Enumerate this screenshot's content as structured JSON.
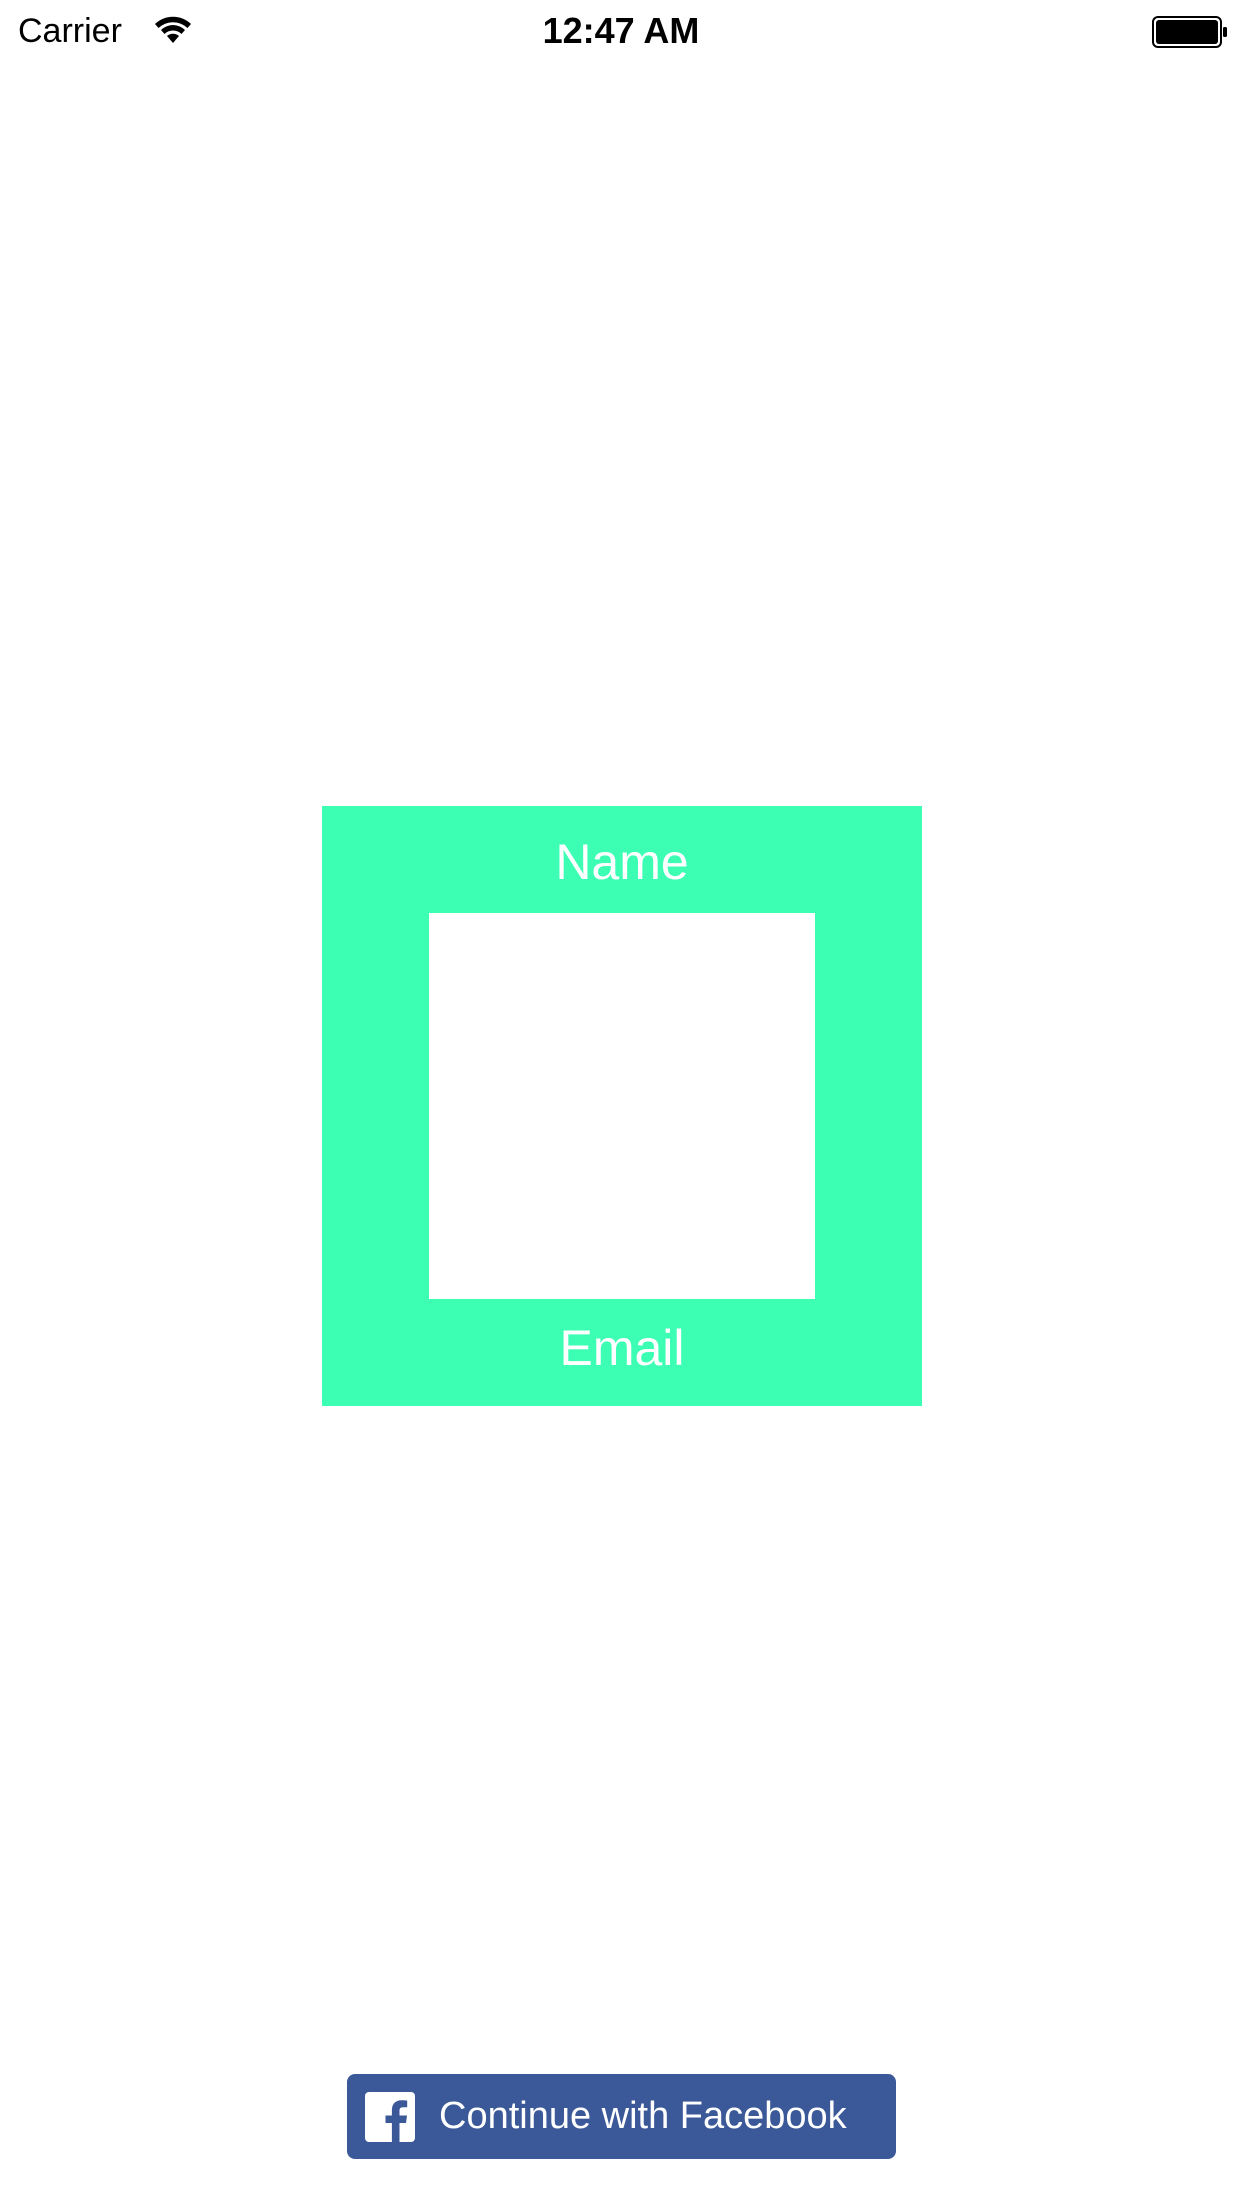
{
  "status_bar": {
    "carrier": "Carrier",
    "time": "12:47 AM",
    "icons": [
      "wifi-icon",
      "battery-icon"
    ]
  },
  "profile": {
    "name_label": "Name",
    "email_label": "Email",
    "accent_color": "#3cffb4"
  },
  "login": {
    "facebook_label": "Continue with Facebook",
    "facebook_icon": "facebook-logo-icon",
    "facebook_color": "#3b5998"
  }
}
